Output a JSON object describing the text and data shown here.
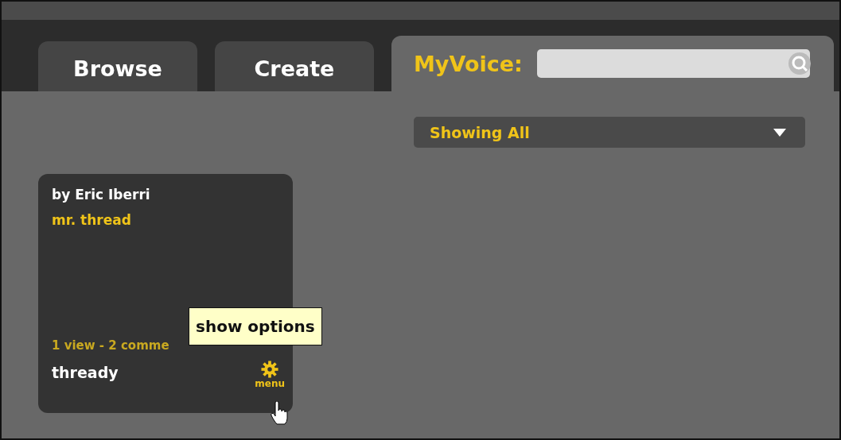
{
  "tabs": [
    {
      "label": "Browse",
      "selected": false
    },
    {
      "label": "Create",
      "selected": false
    },
    {
      "label": "MyVoice:",
      "selected": true
    }
  ],
  "filter": {
    "value": "Showing All"
  },
  "cards": [
    {
      "author": "by Eric Iberri",
      "title": "mr. thread",
      "stats": "1 view - 2 comme",
      "name": "thready",
      "menu_label": "menu",
      "tooltip": "show options"
    }
  ]
}
